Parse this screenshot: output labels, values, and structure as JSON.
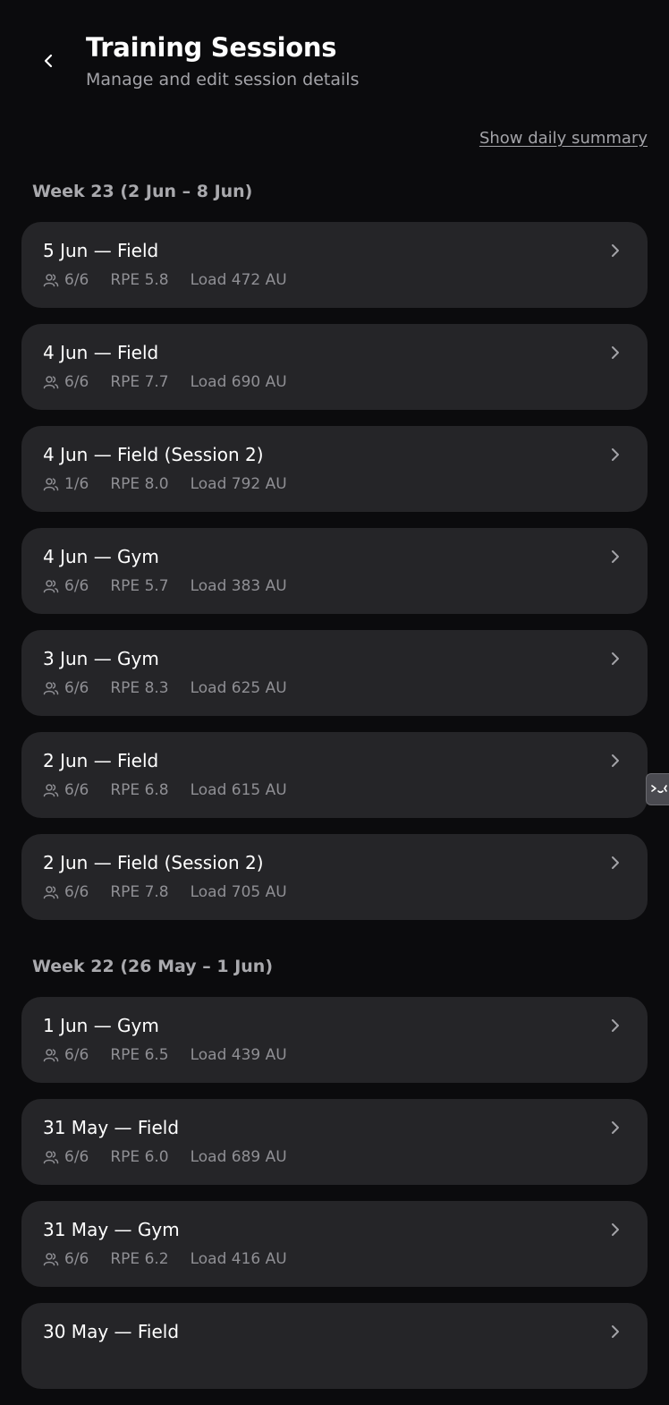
{
  "header": {
    "title": "Training Sessions",
    "subtitle": "Manage and edit session details"
  },
  "summary_link": "Show daily summary",
  "icons": {
    "back": "chevron-left-icon",
    "attendance": "users-icon",
    "open": "chevron-right-icon"
  },
  "weeks": [
    {
      "heading": "Week 23 (2 Jun – 8 Jun)",
      "sessions": [
        {
          "title": "5 Jun — Field",
          "attendance": "6/6",
          "rpe": "RPE 5.8",
          "load": "Load 472 AU"
        },
        {
          "title": "4 Jun — Field",
          "attendance": "6/6",
          "rpe": "RPE 7.7",
          "load": "Load 690 AU"
        },
        {
          "title": "4 Jun — Field (Session 2)",
          "attendance": "1/6",
          "rpe": "RPE 8.0",
          "load": "Load 792 AU"
        },
        {
          "title": "4 Jun — Gym",
          "attendance": "6/6",
          "rpe": "RPE 5.7",
          "load": "Load 383 AU"
        },
        {
          "title": "3 Jun — Gym",
          "attendance": "6/6",
          "rpe": "RPE 8.3",
          "load": "Load 625 AU"
        },
        {
          "title": "2 Jun — Field",
          "attendance": "6/6",
          "rpe": "RPE 6.8",
          "load": "Load 615 AU"
        },
        {
          "title": "2 Jun — Field (Session 2)",
          "attendance": "6/6",
          "rpe": "RPE 7.8",
          "load": "Load 705 AU"
        }
      ]
    },
    {
      "heading": "Week 22 (26 May – 1 Jun)",
      "sessions": [
        {
          "title": "1 Jun — Gym",
          "attendance": "6/6",
          "rpe": "RPE 6.5",
          "load": "Load 439 AU"
        },
        {
          "title": "31 May — Field",
          "attendance": "6/6",
          "rpe": "RPE 6.0",
          "load": "Load 689 AU"
        },
        {
          "title": "31 May — Gym",
          "attendance": "6/6",
          "rpe": "RPE 6.2",
          "load": "Load 416 AU"
        },
        {
          "title": "30 May — Field",
          "attendance": "",
          "rpe": "",
          "load": ""
        }
      ]
    }
  ],
  "side_tab": {
    "icon": "terminal-face-icon"
  }
}
